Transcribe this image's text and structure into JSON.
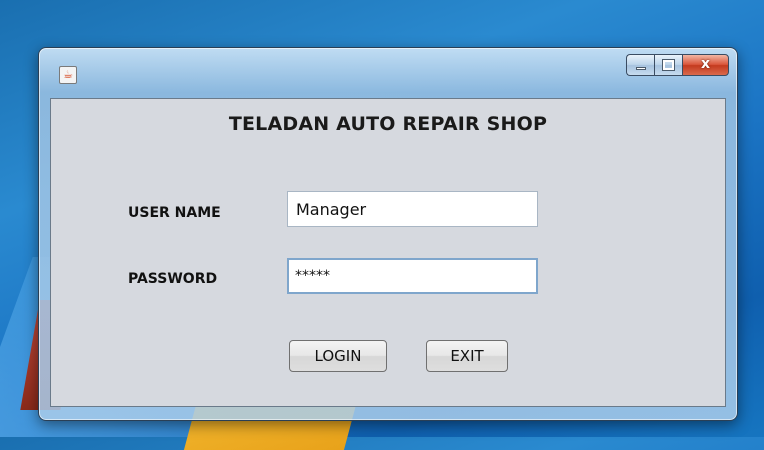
{
  "window": {
    "title": "",
    "controls": {
      "minimize": "minimize",
      "maximize": "maximize",
      "close": "x"
    }
  },
  "form": {
    "heading": "TELADAN AUTO REPAIR SHOP",
    "username_label": "USER NAME",
    "username_value": "Manager",
    "password_label": "PASSWORD",
    "password_value": "*****",
    "login_label": "LOGIN",
    "exit_label": "EXIT"
  },
  "icons": {
    "app": "java-app-icon",
    "minimize": "minimize-icon",
    "maximize": "maximize-icon",
    "close": "close-icon"
  }
}
